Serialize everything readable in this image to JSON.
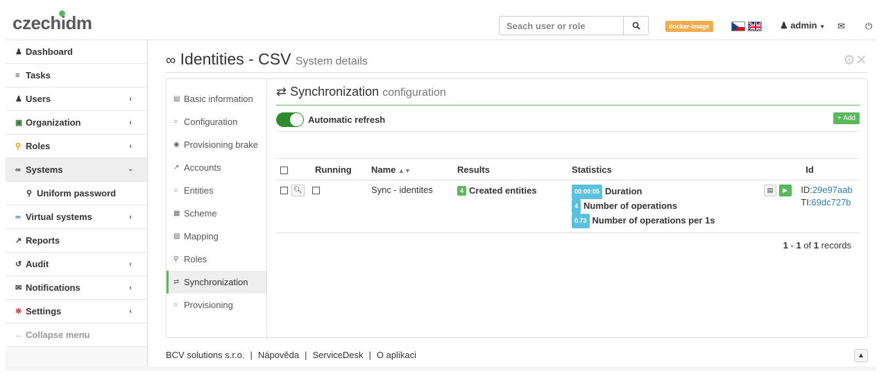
{
  "header": {
    "logo": "czechidm",
    "search_placeholder": "Seach user or role",
    "env_badge": "docker-image",
    "user": "admin",
    "colors": {
      "accent": "#5cb85c",
      "badge": "#f0ad4e",
      "link": "#337ab7"
    }
  },
  "sidebar": {
    "items": [
      {
        "label": "Dashboard",
        "icon": "user-icon",
        "chevron": ""
      },
      {
        "label": "Tasks",
        "icon": "tasks-icon",
        "chevron": ""
      },
      {
        "label": "Users",
        "icon": "users-icon",
        "chevron": "‹"
      },
      {
        "label": "Organization",
        "icon": "folder-icon",
        "chevron": "‹"
      },
      {
        "label": "Roles",
        "icon": "key-icon",
        "chevron": "‹"
      },
      {
        "label": "Systems",
        "icon": "link-icon",
        "chevron": "›"
      },
      {
        "label": "Uniform password",
        "icon": "key-icon",
        "chevron": ""
      },
      {
        "label": "Virtual systems",
        "icon": "link-icon",
        "chevron": "‹"
      },
      {
        "label": "Reports",
        "icon": "chart-icon",
        "chevron": ""
      },
      {
        "label": "Audit",
        "icon": "history-icon",
        "chevron": "‹"
      },
      {
        "label": "Notifications",
        "icon": "envelope-icon",
        "chevron": "‹"
      },
      {
        "label": "Settings",
        "icon": "cog-icon",
        "chevron": "‹"
      },
      {
        "label": "Collapse menu",
        "icon": "arrow-left-icon",
        "chevron": ""
      }
    ]
  },
  "page": {
    "title": "Identities - CSV",
    "subtitle": "System details"
  },
  "subnav": {
    "items": [
      "Basic information",
      "Configuration",
      "Provisioning brake",
      "Accounts",
      "Entities",
      "Scheme",
      "Mapping",
      "Roles",
      "Synchronization",
      "Provisioning"
    ]
  },
  "sync": {
    "title": "Synchronization",
    "subtitle": "configuration",
    "auto_refresh_label": "Automatic refresh",
    "add_label": "Add",
    "columns": [
      "Running",
      "Name",
      "Results",
      "Statistics",
      "Id"
    ],
    "rows": [
      {
        "name": "Sync - identites",
        "result_count": "4",
        "result_label": "Created entities",
        "duration_badge": "00:00:05",
        "duration_label": "Duration",
        "ops_badge": "4",
        "ops_label": "Number of operations",
        "rate_badge": "0.73",
        "rate_label": "Number of operations per 1s",
        "id_prefix": "ID:",
        "id_value": "29e97aab",
        "ti_prefix": "TI:",
        "ti_value": "69dc727b"
      }
    ],
    "pager": {
      "from": "1",
      "to": "1",
      "total": "1",
      "of": "of",
      "records": "records"
    }
  },
  "footer": {
    "company": "BCV solutions s.r.o.",
    "help": "Nápověda",
    "servicedesk": "ServiceDesk",
    "about": "O aplikaci"
  }
}
